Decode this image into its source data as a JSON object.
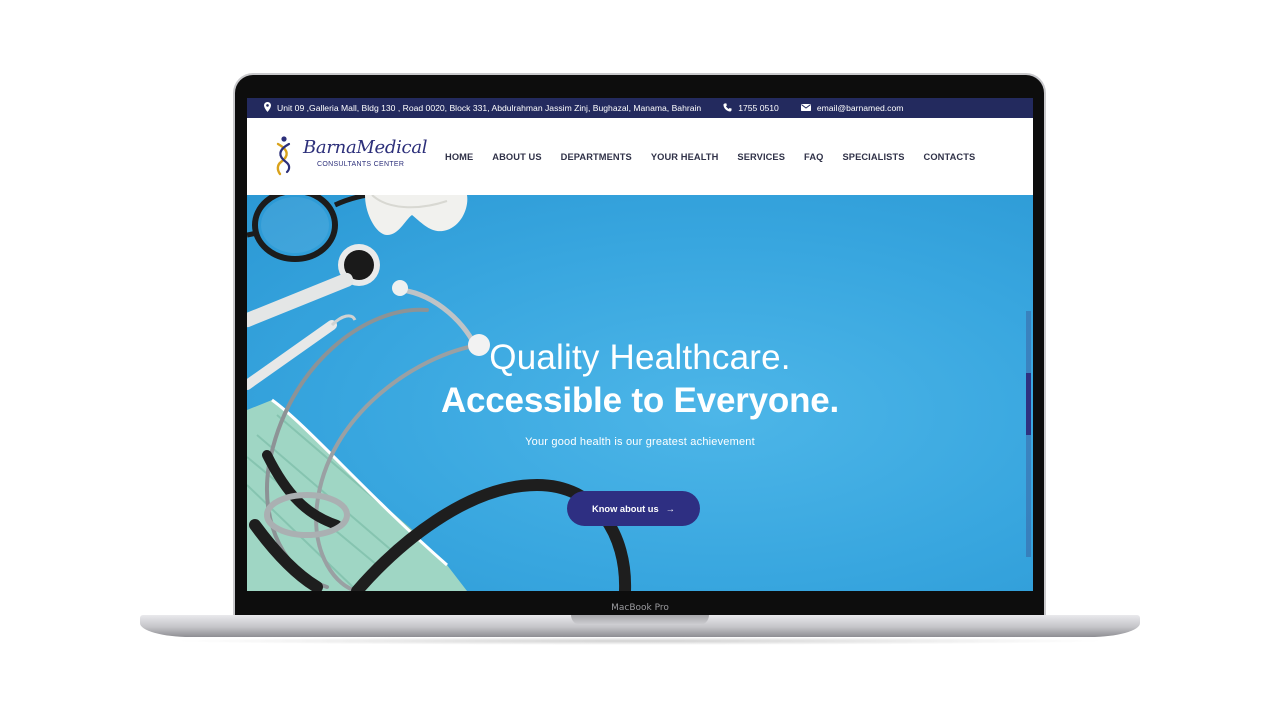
{
  "device": {
    "label": "MacBook Pro"
  },
  "topbar": {
    "address": "Unit 09 ,Galleria Mall, Bldg 130 , Road 0020, Block 331, Abdulrahman Jassim Zinj, Bughazal, Manama, Bahrain",
    "phone": "1755 0510",
    "email": "email@barnamed.com",
    "icons": {
      "address": "map-pin-icon",
      "phone": "phone-icon",
      "email": "envelope-icon"
    },
    "background": "#232a5e"
  },
  "logo": {
    "name": "BarnaMedical",
    "subtitle": "CONSULTANTS CENTER",
    "color": "#2c2f7a"
  },
  "nav": {
    "items": [
      {
        "label": "HOME"
      },
      {
        "label": "ABOUT US"
      },
      {
        "label": "DEPARTMENTS"
      },
      {
        "label": "YOUR HEALTH"
      },
      {
        "label": "SERVICES"
      },
      {
        "label": "FAQ"
      },
      {
        "label": "SPECIALISTS"
      },
      {
        "label": "CONTACTS"
      }
    ]
  },
  "hero": {
    "title_line1": "Quality Healthcare.",
    "title_line2": "Accessible to Everyone.",
    "subtitle": "Your good health is our greatest achievement",
    "cta_label": "Know about us",
    "cta_icon": "arrow-right-icon",
    "background": "#38a6df",
    "cta_color": "#2e2f82"
  }
}
